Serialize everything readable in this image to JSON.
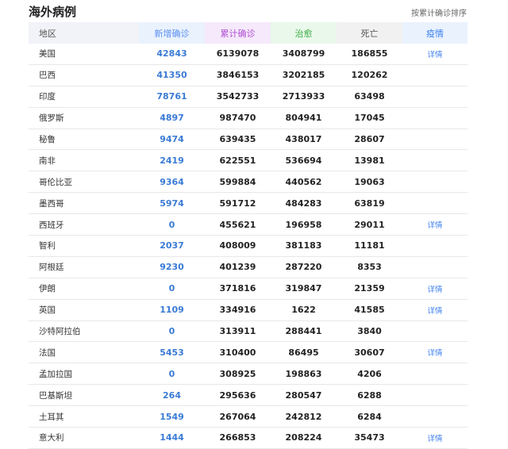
{
  "title": "海外病例",
  "sort_link": "按累计确诊排序",
  "columns": {
    "region": "地区",
    "new": "新增确诊",
    "total": "累计确诊",
    "cured": "治愈",
    "dead": "死亡",
    "detail": "疫情"
  },
  "rows": [
    {
      "region": "美国",
      "new": "42843",
      "total": "6139078",
      "cured": "3408799",
      "dead": "186855",
      "detail": "详情"
    },
    {
      "region": "巴西",
      "new": "41350",
      "total": "3846153",
      "cured": "3202185",
      "dead": "120262",
      "detail": ""
    },
    {
      "region": "印度",
      "new": "78761",
      "total": "3542733",
      "cured": "2713933",
      "dead": "63498",
      "detail": ""
    },
    {
      "region": "俄罗斯",
      "new": "4897",
      "total": "987470",
      "cured": "804941",
      "dead": "17045",
      "detail": ""
    },
    {
      "region": "秘鲁",
      "new": "9474",
      "total": "639435",
      "cured": "438017",
      "dead": "28607",
      "detail": ""
    },
    {
      "region": "南非",
      "new": "2419",
      "total": "622551",
      "cured": "536694",
      "dead": "13981",
      "detail": ""
    },
    {
      "region": "哥伦比亚",
      "new": "9364",
      "total": "599884",
      "cured": "440562",
      "dead": "19063",
      "detail": ""
    },
    {
      "region": "墨西哥",
      "new": "5974",
      "total": "591712",
      "cured": "484283",
      "dead": "63819",
      "detail": ""
    },
    {
      "region": "西班牙",
      "new": "0",
      "total": "455621",
      "cured": "196958",
      "dead": "29011",
      "detail": "详情"
    },
    {
      "region": "智利",
      "new": "2037",
      "total": "408009",
      "cured": "381183",
      "dead": "11181",
      "detail": ""
    },
    {
      "region": "阿根廷",
      "new": "9230",
      "total": "401239",
      "cured": "287220",
      "dead": "8353",
      "detail": ""
    },
    {
      "region": "伊朗",
      "new": "0",
      "total": "371816",
      "cured": "319847",
      "dead": "21359",
      "detail": "详情"
    },
    {
      "region": "英国",
      "new": "1109",
      "total": "334916",
      "cured": "1622",
      "dead": "41585",
      "detail": "详情"
    },
    {
      "region": "沙特阿拉伯",
      "new": "0",
      "total": "313911",
      "cured": "288441",
      "dead": "3840",
      "detail": ""
    },
    {
      "region": "法国",
      "new": "5453",
      "total": "310400",
      "cured": "86495",
      "dead": "30607",
      "detail": "详情"
    },
    {
      "region": "孟加拉国",
      "new": "0",
      "total": "308925",
      "cured": "198863",
      "dead": "4206",
      "detail": ""
    },
    {
      "region": "巴基斯坦",
      "new": "264",
      "total": "295636",
      "cured": "280547",
      "dead": "6288",
      "detail": ""
    },
    {
      "region": "土耳其",
      "new": "1549",
      "total": "267064",
      "cured": "242812",
      "dead": "6284",
      "detail": ""
    },
    {
      "region": "意大利",
      "new": "1444",
      "total": "266853",
      "cured": "208224",
      "dead": "35473",
      "detail": "详情"
    }
  ]
}
